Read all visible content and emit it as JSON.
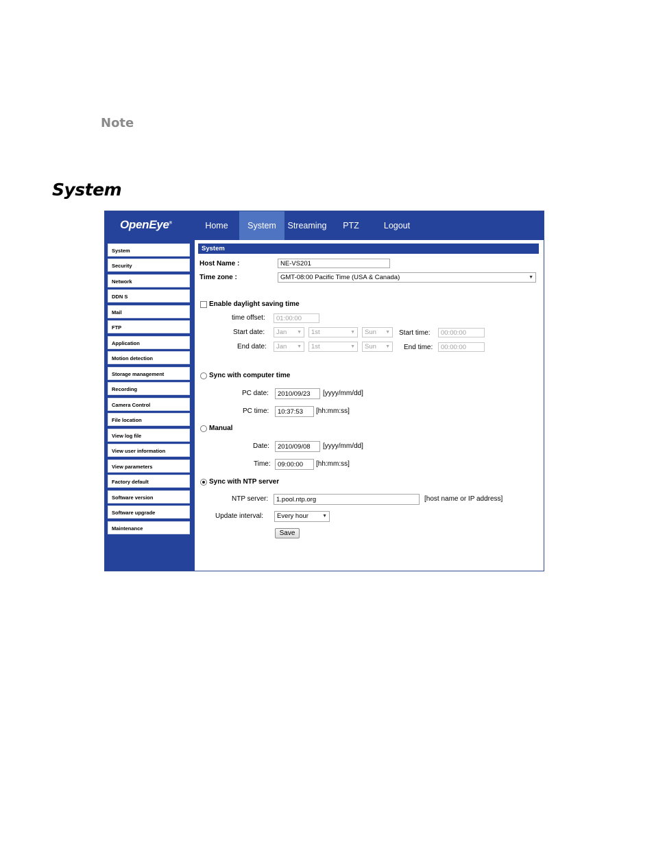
{
  "note": "Note",
  "section_title": "System",
  "app": {
    "logo": "OpenEye",
    "logo_mark": "®",
    "nav": [
      "Home",
      "System",
      "Streaming",
      "PTZ",
      "Logout"
    ],
    "active_nav": "System",
    "sidebar": [
      "System",
      "Security",
      "Network",
      "DDN S",
      "Mail",
      "FTP",
      "Application",
      "Motion detection",
      "Storage management",
      "Recording",
      "Camera Control",
      "File location",
      "View log file",
      "View user information",
      "View parameters",
      "Factory default",
      "Software version",
      "Software upgrade",
      "Maintenance"
    ],
    "panel_title": "System",
    "host_name_label": "Host Name :",
    "host_name_value": "NE-VS201",
    "time_zone_label": "Time zone :",
    "time_zone_value": "GMT-08:00 Pacific Time (USA & Canada)",
    "dst": {
      "label": "Enable daylight saving time",
      "offset_label": "time offset:",
      "offset_value": "01:00:00",
      "start_date_label": "Start date:",
      "start_month": "Jan",
      "start_week": "1st",
      "start_day": "Sun",
      "start_time_label": "Start time:",
      "start_time_value": "00:00:00",
      "end_date_label": "End date:",
      "end_month": "Jan",
      "end_week": "1st",
      "end_day": "Sun",
      "end_time_label": "End time:",
      "end_time_value": "00:00:00"
    },
    "sync_pc": {
      "label": "Sync with computer time",
      "date_label": "PC date:",
      "date_value": "2010/09/23",
      "date_format": "[yyyy/mm/dd]",
      "time_label": "PC time:",
      "time_value": "10:37:53",
      "time_format": "[hh:mm:ss]"
    },
    "manual": {
      "label": "Manual",
      "date_label": "Date:",
      "date_value": "2010/09/08",
      "date_format": "[yyyy/mm/dd]",
      "time_label": "Time:",
      "time_value": "09:00:00",
      "time_format": "[hh:mm:ss]"
    },
    "ntp": {
      "label": "Sync with NTP server",
      "server_label": "NTP server:",
      "server_value": "1.pool.ntp.org",
      "server_hint": "[host name or IP address]",
      "interval_label": "Update interval:",
      "interval_value": "Every hour"
    },
    "save_label": "Save",
    "selected_mode": "ntp"
  }
}
